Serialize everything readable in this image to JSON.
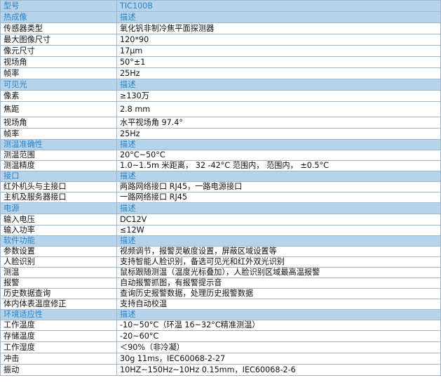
{
  "spec_table": {
    "rows": [
      {
        "kind": "header",
        "label": "型号",
        "value": "TIC100B"
      },
      {
        "kind": "header",
        "label": "热成像",
        "value": "描述"
      },
      {
        "kind": "data",
        "label": "传感器类型",
        "value": "氧化钒非制冷焦平面探测器"
      },
      {
        "kind": "data",
        "label": "最大图像尺寸",
        "value": "120*90"
      },
      {
        "kind": "data",
        "label": "像元尺寸",
        "value": "17μm"
      },
      {
        "kind": "data",
        "label": "视场角",
        "value": "50°±1"
      },
      {
        "kind": "data",
        "label": "帧率",
        "value": "25Hz"
      },
      {
        "kind": "header",
        "label": "可见光",
        "value": "描述"
      },
      {
        "kind": "data",
        "label": "像素",
        "value": "≥130万"
      },
      {
        "kind": "data",
        "label": "焦距",
        "value": "2.8 mm"
      },
      {
        "kind": "data",
        "label": "视场角",
        "value": "水平视场角 97.4°"
      },
      {
        "kind": "data",
        "label": "帧率",
        "value": "25Hz"
      },
      {
        "kind": "header",
        "label": "测温准确性",
        "value": "描述"
      },
      {
        "kind": "data",
        "label": "测温范围",
        "value": "20°C~50°C"
      },
      {
        "kind": "data",
        "label": "测温精度",
        "value": "1.0~1.5m 米距离， 32 -42°C 范围内， 范围内， ±0.5°C"
      },
      {
        "kind": "header",
        "label": "接口",
        "value": "描述"
      },
      {
        "kind": "data",
        "label": "红外机头与主接口",
        "value": "两路网络接口 RJ45，一路电源接口"
      },
      {
        "kind": "data",
        "label": "主机及服务器接口",
        "value": "一路网络接口 RJ45"
      },
      {
        "kind": "header",
        "label": "电源",
        "value": "描述"
      },
      {
        "kind": "data",
        "label": "输入电压",
        "value": "DC12V"
      },
      {
        "kind": "data",
        "label": "输入功率",
        "value": "≤12W"
      },
      {
        "kind": "header",
        "label": "软件功能",
        "value": "描述"
      },
      {
        "kind": "data",
        "label": "参数设置",
        "value": "视频调节，报警灵敏度设置，屏蔽区域设置等"
      },
      {
        "kind": "data",
        "label": "人脸识别",
        "value": "支持智能人脸识别，备选可见光和红外双光识别"
      },
      {
        "kind": "data",
        "label": "测温",
        "value": "鼠标跟随测温（温度光标叠加），人脸识别区域最高温报警"
      },
      {
        "kind": "data",
        "label": "报警",
        "value": "自动报警抓图，有报警提示音"
      },
      {
        "kind": "data",
        "label": "历史数据查询",
        "value": "查询历史报警数据，处理历史报警数据"
      },
      {
        "kind": "data",
        "label": "体内体表温度修正",
        "value": "支持自动校温"
      },
      {
        "kind": "header",
        "label": "环境适应性",
        "value": "描述"
      },
      {
        "kind": "data",
        "label": "工作温度",
        "value": "-10~50°C（环温 16~32°C精准测温）"
      },
      {
        "kind": "data",
        "label": "存储温度",
        "value": "-20~60°C"
      },
      {
        "kind": "data",
        "label": "工作湿度",
        "value": "＜90%（非冷凝）"
      },
      {
        "kind": "data",
        "label": "冲击",
        "value": "30g 11ms，IEC60068-2-27"
      },
      {
        "kind": "data",
        "label": "振动",
        "value": "10HZ~150Hz~10Hz 0.15mm，IEC60068-2-6"
      }
    ]
  }
}
